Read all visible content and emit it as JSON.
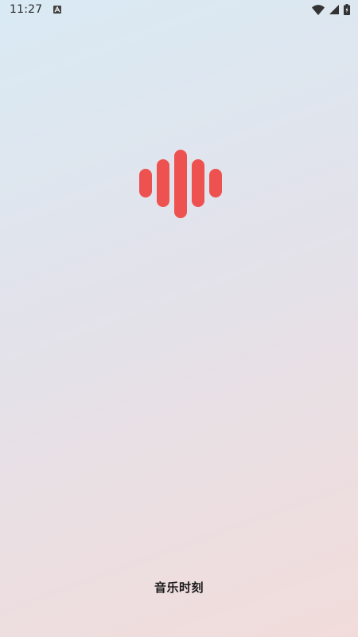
{
  "status_bar": {
    "time": "11:27",
    "icons": [
      "a-notification-icon",
      "wifi-icon",
      "cellular-signal-icon",
      "battery-icon"
    ]
  },
  "splash": {
    "logo": "sound-wave-icon",
    "app_name": "音乐时刻"
  },
  "colors": {
    "accent": "#ee5250",
    "background_top": "#d9eaf4",
    "background_bottom": "#f2dcdb"
  }
}
